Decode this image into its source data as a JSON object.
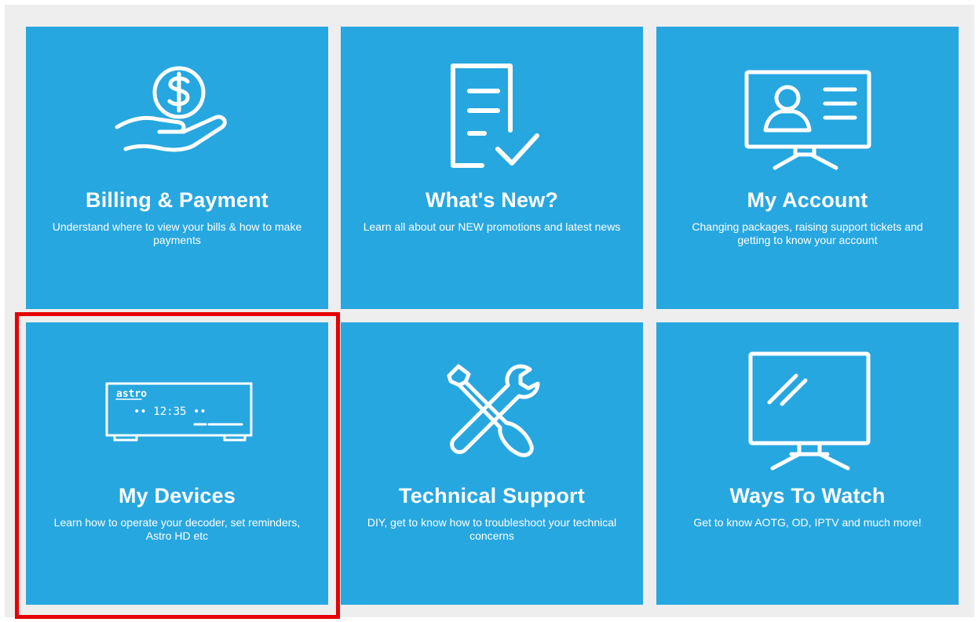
{
  "tiles": [
    {
      "title": "Billing & Payment",
      "description": "Understand where to view your bills & how to make payments",
      "icon": "hand-dollar-coin-icon"
    },
    {
      "title": "What's New?",
      "description": "Learn all about our NEW promotions and latest news",
      "icon": "document-check-icon"
    },
    {
      "title": "My Account",
      "description": "Changing packages, raising support tickets and getting to know your account",
      "icon": "monitor-profile-icon"
    },
    {
      "title": "My Devices",
      "description": "Learn how to operate your decoder, set reminders, Astro HD etc",
      "icon": "decoder-icon",
      "decoder_brand": "astro",
      "decoder_time": "•• 12:35 ••"
    },
    {
      "title": "Technical Support",
      "description": "DIY, get to know how to troubleshoot your technical concerns",
      "icon": "wrench-screwdriver-icon"
    },
    {
      "title": "Ways To Watch",
      "description": "Get to know AOTG, OD, IPTV and much more!",
      "icon": "tv-icon"
    }
  ],
  "colors": {
    "tile": "#27a7e0",
    "panel": "#eeeeee",
    "highlight": "#e60000"
  }
}
